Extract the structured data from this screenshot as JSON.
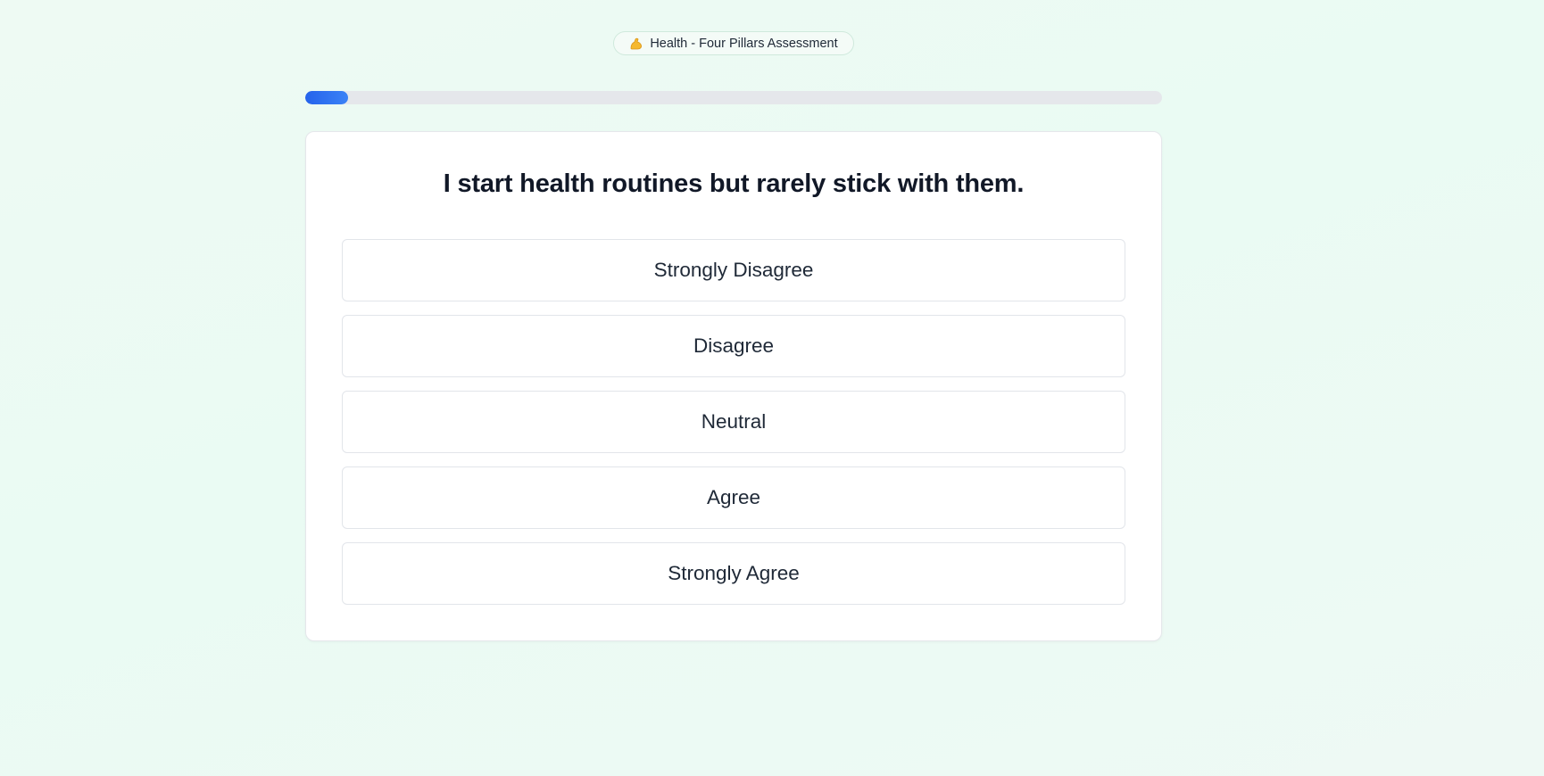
{
  "header": {
    "icon": "flexed-biceps-icon",
    "label": "Health - Four Pillars Assessment"
  },
  "progress": {
    "fraction": 0.05
  },
  "question": {
    "text": "I start health routines but rarely stick with them."
  },
  "options": [
    {
      "label": "Strongly Disagree"
    },
    {
      "label": "Disagree"
    },
    {
      "label": "Neutral"
    },
    {
      "label": "Agree"
    },
    {
      "label": "Strongly Agree"
    }
  ],
  "colors": {
    "accent": "#2563eb",
    "progress_track": "#e5e7eb",
    "background": "#ecfaf3",
    "icon": "#f5b82e"
  }
}
